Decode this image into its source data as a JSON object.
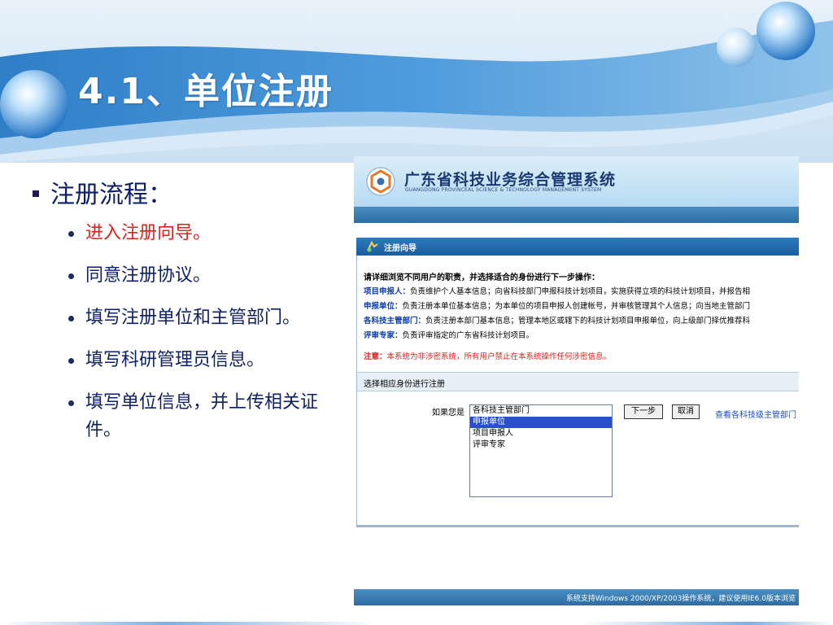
{
  "slide": {
    "title": "4.1、单位注册"
  },
  "bullets": {
    "heading": "注册流程：",
    "steps": [
      "进入注册向导。",
      "同意注册协议。",
      "填写注册单位和主管部门。",
      "填写科研管理员信息。",
      "填写单位信息，并上传相关证件。"
    ],
    "highlight_color": "#e0201c"
  },
  "screenshot": {
    "system_title": "广东省科技业务综合管理系统",
    "system_subtitle": "GUANGDONG PROVINCEAL SCIENCE & TECHNOLOGY MANAGEMENT SYSTEM",
    "wizard_title": "注册向导",
    "intro": "请详细浏览不同用户的职责，并选择适合的身份进行下一步操作：",
    "roles": [
      {
        "name": "项目申报人：",
        "desc": "负责维护个人基本信息；向省科技部门申报科技计划项目，实施获得立项的科技计划项目，并报告相"
      },
      {
        "name": "申报单位：",
        "desc": "负责注册本单位基本信息；为本单位的项目申报人创建帐号，并审核管理其个人信息；向当地主管部门"
      },
      {
        "name": "各科技主管部门：",
        "desc": "负责注册本部门基本信息；管理本地区或辖下的科技计划项目申报单位，向上级部门择优推荐科"
      },
      {
        "name": "评审专家：",
        "desc": "负责评审指定的广东省科技计划项目。"
      }
    ],
    "note_label": "注意：",
    "note_text": "本系统为非涉密系统，所有用户禁止在本系统操作任何涉密信息。",
    "choose_label": "选择相应身份进行注册",
    "if_label": "如果您是",
    "options": [
      "各科技主管部门",
      "申报单位",
      "项目申报人",
      "评审专家"
    ],
    "selected_index": 1,
    "next_button": "下一步",
    "cancel_button": "取消",
    "view_link": "查看各科技级主管部门",
    "footer": "系统支持Windows 2000/XP/2003操作系统，建议使用IE6.0版本浏览"
  },
  "icons": [
    "decorative-bubble-icon",
    "system-logo-icon",
    "wizard-icon"
  ],
  "colors": {
    "title": "#ffffff",
    "body_text": "#0d1f66",
    "link": "#1a4fc4",
    "selected_option": "#2a50c8"
  }
}
